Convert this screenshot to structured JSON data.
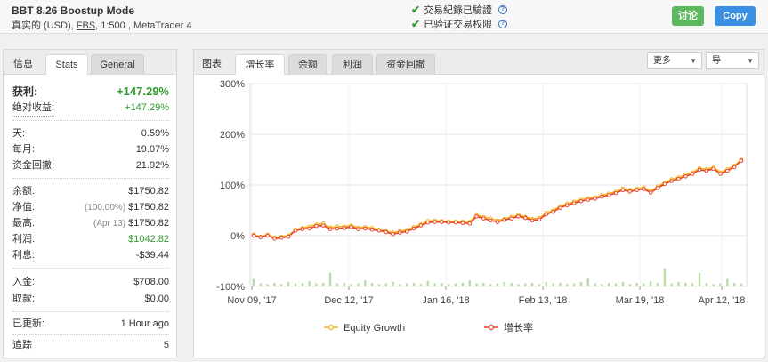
{
  "header": {
    "title": "BBT 8.26 Boostup Mode",
    "sub_prefix": "真实的 (USD),",
    "broker": "FBS",
    "sub_suffix": ", 1:500 , MetaTrader 4",
    "verify1": "交易紀錄已驗證",
    "verify2": "已验证交易权限",
    "help_glyph": "?",
    "check_glyph": "✔",
    "discuss_label": "讨论",
    "copy_label": "Copy"
  },
  "left_tabs": [
    "信息",
    "Stats",
    "General"
  ],
  "stats": {
    "profit_label": "获利:",
    "profit_value": "+147.29%",
    "abs_label": "绝对收益:",
    "abs_value": "+147.29%",
    "day_label": "天:",
    "day_value": "0.59%",
    "month_label": "每月:",
    "month_value": "19.07%",
    "dd_label": "资金回撤:",
    "dd_value": "21.92%",
    "balance_label": "余额:",
    "balance_value": "$1750.82",
    "equity_label": "净值:",
    "equity_sub": "(100.00%)",
    "equity_value": "$1750.82",
    "high_label": "最高:",
    "high_sub": "(Apr 13)",
    "high_value": "$1750.82",
    "profitamt_label": "利润:",
    "profitamt_value": "$1042.82",
    "interest_label": "利息:",
    "interest_value": "-$39.44",
    "deposit_label": "入金:",
    "deposit_value": "$708.00",
    "withdraw_label": "取款:",
    "withdraw_value": "$0.00",
    "updated_label": "已更新:",
    "updated_value": "1 Hour ago",
    "track_label": "追踪",
    "track_value": "5"
  },
  "right_tabs": [
    "图表",
    "增长率",
    "余额",
    "利润",
    "资金回撤"
  ],
  "controls": {
    "more_label": "更多",
    "export_label": "导",
    "arrow_glyph": "▼"
  },
  "chart_data": {
    "type": "line",
    "x": [
      "Nov 09, '17",
      "Dec 12, '17",
      "Jan 16, '18",
      "Feb 13, '18",
      "Mar 19, '18",
      "Apr 12, '18"
    ],
    "y_ticks": [
      "300%",
      "200%",
      "100%",
      "0%",
      "-100%"
    ],
    "ylim": [
      -100,
      300
    ],
    "grid": true,
    "legend_placement": "bottom",
    "series": [
      {
        "name": "Equity Growth",
        "color": "#f5b31b"
      },
      {
        "name": "增长率",
        "color": "#e8432c"
      }
    ],
    "growth_values": [
      0,
      -3,
      0,
      -6,
      -4,
      -2,
      10,
      13,
      14,
      19,
      20,
      13,
      14,
      15,
      17,
      13,
      14,
      12,
      10,
      7,
      3,
      6,
      8,
      14,
      20,
      26,
      27,
      27,
      26,
      26,
      25,
      24,
      38,
      34,
      30,
      27,
      31,
      34,
      38,
      35,
      30,
      32,
      42,
      47,
      55,
      60,
      64,
      68,
      71,
      73,
      77,
      80,
      84,
      90,
      87,
      90,
      92,
      85,
      94,
      102,
      108,
      112,
      117,
      122,
      130,
      128,
      132,
      122,
      128,
      135,
      148
    ],
    "equity_values": [
      2,
      -2,
      2,
      -4,
      -2,
      0,
      12,
      15,
      18,
      22,
      24,
      16,
      18,
      18,
      20,
      16,
      17,
      15,
      12,
      9,
      6,
      9,
      11,
      17,
      22,
      29,
      30,
      29,
      28,
      28,
      28,
      27,
      41,
      37,
      34,
      30,
      33,
      37,
      41,
      37,
      33,
      35,
      45,
      50,
      58,
      63,
      67,
      71,
      74,
      76,
      80,
      83,
      87,
      93,
      90,
      93,
      95,
      88,
      97,
      105,
      111,
      115,
      120,
      125,
      133,
      131,
      135,
      125,
      131,
      138,
      150
    ],
    "bar_values": [
      25,
      10,
      8,
      12,
      8,
      15,
      10,
      12,
      18,
      10,
      12,
      45,
      10,
      12,
      8,
      10,
      20,
      12,
      8,
      10,
      15,
      8,
      10,
      12,
      8,
      18,
      10,
      12,
      8,
      10,
      12,
      20,
      10,
      12,
      8,
      10,
      15,
      12,
      8,
      10,
      12,
      8,
      15,
      10,
      12,
      8,
      10,
      15,
      28,
      10,
      8,
      12,
      10,
      15,
      8,
      12,
      10,
      18,
      12,
      60,
      10,
      15,
      12,
      10,
      45,
      12,
      8,
      10,
      25,
      12,
      10
    ]
  }
}
